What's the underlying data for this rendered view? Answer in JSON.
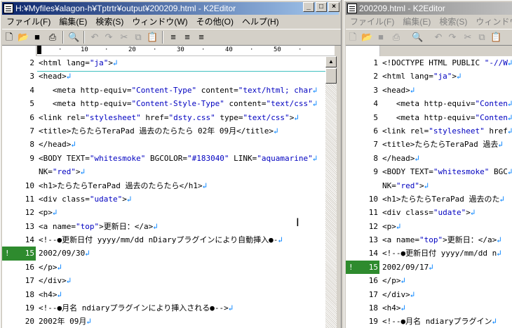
{
  "colors": {
    "active_title": "#0a246a",
    "inactive_title": "#808080",
    "string": "#0000c0",
    "marker": "#2e8b2e"
  },
  "window1": {
    "title": "H:¥Myfiles¥alagon-h¥Tptrtr¥output¥200209.html - K2Editor",
    "menu": [
      "ファイル(F)",
      "編集(E)",
      "検索(S)",
      "ウィンドウ(W)",
      "その他(O)",
      "ヘルプ(H)"
    ],
    "ruler": [
      "10",
      "20",
      "30",
      "40",
      "50"
    ],
    "lines": [
      {
        "n": "2",
        "parts": [
          [
            "t",
            "<html lang="
          ],
          [
            "v",
            "\"ja\""
          ],
          [
            "t",
            ">"
          ]
        ]
      },
      {
        "n": "3",
        "parts": [
          [
            "t",
            "<head>"
          ]
        ]
      },
      {
        "n": "4",
        "parts": [
          [
            "t",
            "   <meta http-equiv="
          ],
          [
            "v",
            "\"Content-Type\""
          ],
          [
            "t",
            " content="
          ],
          [
            "v",
            "\"text/html; char"
          ]
        ]
      },
      {
        "n": "5",
        "parts": [
          [
            "t",
            "   <meta http-equiv="
          ],
          [
            "v",
            "\"Content-Style-Type\""
          ],
          [
            "t",
            " content="
          ],
          [
            "v",
            "\"text/css\""
          ]
        ]
      },
      {
        "n": "6",
        "parts": [
          [
            "t",
            "<link rel="
          ],
          [
            "v",
            "\"stylesheet\""
          ],
          [
            "t",
            " href="
          ],
          [
            "v",
            "\"dsty.css\""
          ],
          [
            "t",
            " type="
          ],
          [
            "v",
            "\"text/css\""
          ],
          [
            "t",
            ">"
          ]
        ]
      },
      {
        "n": "7",
        "parts": [
          [
            "t",
            "<title>たらたらTeraPad 過去のたらたら 02年 09月</title>"
          ]
        ]
      },
      {
        "n": "8",
        "parts": [
          [
            "t",
            "</head>"
          ]
        ]
      },
      {
        "n": "9",
        "parts": [
          [
            "t",
            "<BODY TEXT="
          ],
          [
            "v",
            "\"whitesmoke\""
          ],
          [
            "t",
            " BGCOLOR="
          ],
          [
            "v",
            "\"#183040\""
          ],
          [
            "t",
            " LINK="
          ],
          [
            "v",
            "\"aquamarine\""
          ]
        ]
      },
      {
        "n": "",
        "parts": [
          [
            "t",
            "NK="
          ],
          [
            "v",
            "\"red\""
          ],
          [
            "t",
            ">"
          ]
        ]
      },
      {
        "n": "10",
        "parts": [
          [
            "t",
            "<h1>たらたらTeraPad 過去のたらたら</h1>"
          ]
        ]
      },
      {
        "n": "11",
        "parts": [
          [
            "t",
            "<div class="
          ],
          [
            "v",
            "\"udate\""
          ],
          [
            "t",
            ">"
          ]
        ]
      },
      {
        "n": "12",
        "parts": [
          [
            "t",
            "<p>"
          ]
        ]
      },
      {
        "n": "13",
        "parts": [
          [
            "t",
            "<a name="
          ],
          [
            "v",
            "\"top\""
          ],
          [
            "t",
            ">更新日：</a>"
          ]
        ]
      },
      {
        "n": "14",
        "parts": [
          [
            "t",
            "<!--●更新日付 yyyy/mm/dd nDiaryプラグインにより自動挿入●-"
          ]
        ]
      },
      {
        "n": "15",
        "mark": true,
        "parts": [
          [
            "t",
            "2002/09/30"
          ]
        ]
      },
      {
        "n": "16",
        "parts": [
          [
            "t",
            "</p>"
          ]
        ]
      },
      {
        "n": "17",
        "parts": [
          [
            "t",
            "</div>"
          ]
        ]
      },
      {
        "n": "18",
        "parts": [
          [
            "t",
            "<h4>"
          ]
        ]
      },
      {
        "n": "19",
        "parts": [
          [
            "t",
            "<!--●月名 ndiaryプラグインにより挿入される●-->"
          ]
        ]
      },
      {
        "n": "20",
        "parts": [
          [
            "t",
            "2002年 09月"
          ]
        ]
      }
    ]
  },
  "window2": {
    "title": "200209.html - K2Editor",
    "menu": [
      "ファイル(F)",
      "編集(E)",
      "検索(S)",
      "ウィンドウ(W)"
    ],
    "lines": [
      {
        "n": "1",
        "parts": [
          [
            "t",
            "<!DOCTYPE HTML PUBLIC "
          ],
          [
            "v",
            "\"-//W"
          ]
        ]
      },
      {
        "n": "2",
        "parts": [
          [
            "t",
            "<html lang="
          ],
          [
            "v",
            "\"ja\""
          ],
          [
            "t",
            ">"
          ]
        ]
      },
      {
        "n": "3",
        "parts": [
          [
            "t",
            "<head>"
          ]
        ]
      },
      {
        "n": "4",
        "parts": [
          [
            "t",
            "   <meta http-equiv="
          ],
          [
            "v",
            "\"Conten"
          ]
        ]
      },
      {
        "n": "5",
        "parts": [
          [
            "t",
            "   <meta http-equiv="
          ],
          [
            "v",
            "\"Conten"
          ]
        ]
      },
      {
        "n": "6",
        "parts": [
          [
            "t",
            "<link rel="
          ],
          [
            "v",
            "\"stylesheet\""
          ],
          [
            "t",
            " href"
          ]
        ]
      },
      {
        "n": "7",
        "parts": [
          [
            "t",
            "<title>たらたらTeraPad 過去"
          ]
        ]
      },
      {
        "n": "8",
        "parts": [
          [
            "t",
            "</head>"
          ]
        ]
      },
      {
        "n": "9",
        "parts": [
          [
            "t",
            "<BODY TEXT="
          ],
          [
            "v",
            "\"whitesmoke\""
          ],
          [
            "t",
            " BGC"
          ]
        ]
      },
      {
        "n": "",
        "parts": [
          [
            "t",
            "NK="
          ],
          [
            "v",
            "\"red\""
          ],
          [
            "t",
            ">"
          ]
        ]
      },
      {
        "n": "10",
        "parts": [
          [
            "t",
            "<h1>たらたらTeraPad 過去のた"
          ]
        ]
      },
      {
        "n": "11",
        "parts": [
          [
            "t",
            "<div class="
          ],
          [
            "v",
            "\"udate\""
          ],
          [
            "t",
            ">"
          ]
        ]
      },
      {
        "n": "12",
        "parts": [
          [
            "t",
            "<p>"
          ]
        ]
      },
      {
        "n": "13",
        "parts": [
          [
            "t",
            "<a name="
          ],
          [
            "v",
            "\"top\""
          ],
          [
            "t",
            ">更新日：</a>"
          ]
        ]
      },
      {
        "n": "14",
        "parts": [
          [
            "t",
            "<!--●更新日付 yyyy/mm/dd n"
          ]
        ]
      },
      {
        "n": "15",
        "mark": true,
        "parts": [
          [
            "t",
            "2002/09/17"
          ]
        ]
      },
      {
        "n": "16",
        "parts": [
          [
            "t",
            "</p>"
          ]
        ]
      },
      {
        "n": "17",
        "parts": [
          [
            "t",
            "</div>"
          ]
        ]
      },
      {
        "n": "18",
        "parts": [
          [
            "t",
            "<h4>"
          ]
        ]
      },
      {
        "n": "19",
        "parts": [
          [
            "t",
            "<!--●月名 ndiaryプラグイン"
          ]
        ]
      }
    ]
  }
}
